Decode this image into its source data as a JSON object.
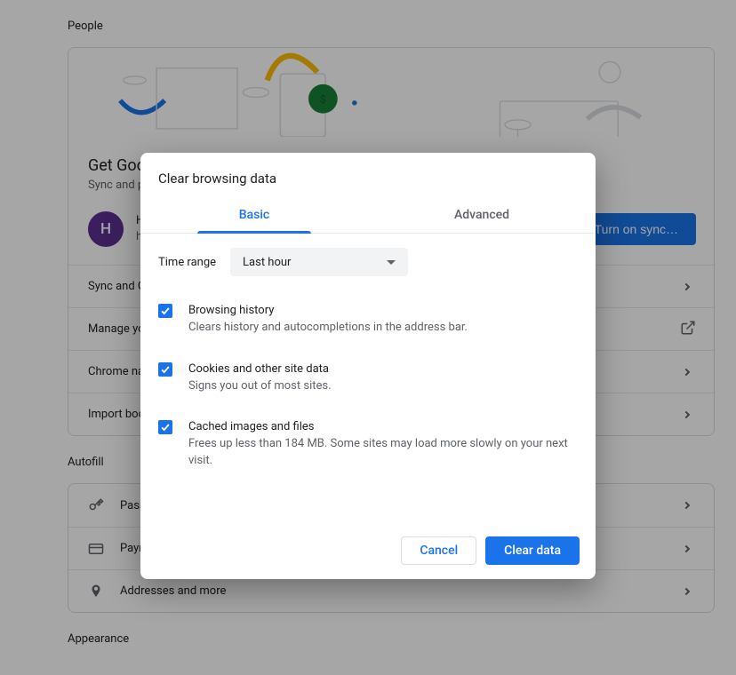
{
  "sections": {
    "people": {
      "title": "People"
    },
    "autofill": {
      "title": "Autofill"
    },
    "appearance": {
      "title": "Appearance"
    }
  },
  "people_card": {
    "heading": "Get Google smarts in Chrome",
    "subheading": "Sync and personalize Chrome across your devices",
    "account": {
      "initial": "H",
      "name": "H",
      "email": "h"
    },
    "sync_button": "Turn on sync…",
    "rows": {
      "sync": {
        "label": "Sync and Google services"
      },
      "manage": {
        "label": "Manage your Google Account"
      },
      "name": {
        "label": "Chrome name and picture"
      },
      "import": {
        "label": "Import bookmarks and settings"
      }
    }
  },
  "autofill_rows": {
    "passwords": {
      "label": "Passwords"
    },
    "payment": {
      "label": "Payment methods"
    },
    "addresses": {
      "label": "Addresses and more"
    }
  },
  "dialog": {
    "title": "Clear browsing data",
    "tabs": {
      "basic": "Basic",
      "advanced": "Advanced",
      "selected": "basic"
    },
    "time_range_label": "Time range",
    "time_range_value": "Last hour",
    "options": {
      "history": {
        "title": "Browsing history",
        "subtitle": "Clears history and autocompletions in the address bar.",
        "checked": true
      },
      "cookies": {
        "title": "Cookies and other site data",
        "subtitle": "Signs you out of most sites.",
        "checked": true
      },
      "cache": {
        "title": "Cached images and files",
        "subtitle": "Frees up less than 184 MB. Some sites may load more slowly on your next visit.",
        "checked": true
      }
    },
    "cancel": "Cancel",
    "confirm": "Clear data"
  }
}
